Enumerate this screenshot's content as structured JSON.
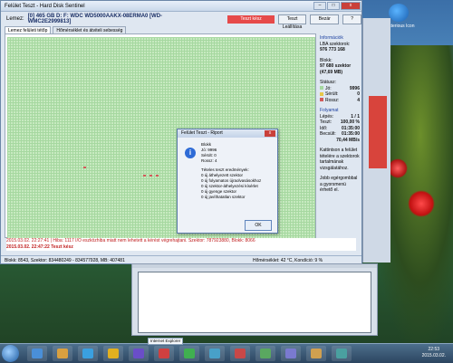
{
  "window": {
    "title": "Felület Teszt - Hard Disk Sentinel",
    "minimize": "–",
    "maximize": "□",
    "close": "x"
  },
  "drivebar": {
    "label": "Lemez:",
    "drive": "[0] 465 GB D: F: WDC WD5000AAKX-08ERMA0 [WD-WMC2E2999813]",
    "status": "Teszt kész",
    "stop_button": "Teszt Leállítása",
    "start_button": "Bezár",
    "extra_button": "?"
  },
  "tabs": [
    {
      "label": "Lemez felületi tétőp"
    },
    {
      "label": "Hőmérséklet és átviteli sebesség"
    }
  ],
  "info": {
    "lba_label": "Információk",
    "lba_sub": "LBA szektorok:",
    "lba_value": "976 773 168",
    "blocks_label": "Blokk:",
    "blocks_value": "97 680 szektor",
    "blocks_sub": "(47,69 MB)",
    "status_label": "Státusz:",
    "ok_label": "Jó:",
    "ok_value": "9996",
    "damaged_label": "Sérült:",
    "damaged_value": "0",
    "bad_label": "Rossz:",
    "bad_value": "4",
    "progress_label": "Folyamat",
    "pass_label": "Lépés:",
    "pass_value": "1 / 1",
    "test_label": "Teszt:",
    "test_value": "100,00 %",
    "time_label": "Idő:",
    "time_value": "01:35:00",
    "est_label": "Becsült:",
    "est_value": "01:35:00",
    "speed_value": "70,44 MB/s",
    "note1": "Kattintson a felület tételére a szektorok tartalmának vizsgálatához.",
    "note2": "Jobb egérgombbal a gyorsmenü érhető el."
  },
  "log": {
    "line1": "2015.03.02.   22:27:41 | Hiba: 1117 I/O eszközhiba miatt nem lehetett a kérést végrehajtani. Szektor: 787923880, Blokk: 8066",
    "line2": "2015.03.02.   22:47:22   Teszt kész"
  },
  "statusbar": {
    "left": "Blokk: 8543, Szektor: 834480249 - 834577928, MB: 407481",
    "right": "Hőmérséklet: 42 °C,  Kondíció: 9 %"
  },
  "dialog": {
    "title": "Felület Teszt - Riport",
    "close": "x",
    "lines": [
      "Blokk",
      "Jó: 9996",
      "Sérült: 0",
      "Rossz: 4",
      "",
      "Tételes teszt eredmények:",
      "0 új áthelyezett szektor",
      "0 új folyamatos újraolvasásokhoz",
      "0 új szektor-áthelyezési kísérlet",
      "0 új gyenge szektor",
      "0 új javíthatatlan szektor"
    ],
    "ok": "OK"
  },
  "desktop_icon": {
    "label": "Mysterious Icon"
  },
  "taskbar": {
    "tooltip": "Internet Explorer",
    "time": "22:53",
    "date": "2015.03.02."
  },
  "colors": {
    "status_red": "#e64a4a",
    "grid_green": "#c7eac0",
    "bad_block": "#d25a5a"
  }
}
